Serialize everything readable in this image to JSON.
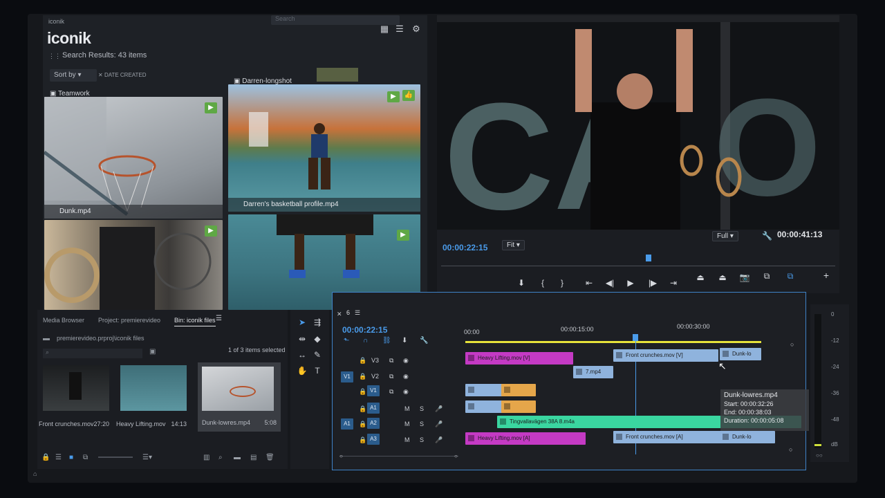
{
  "iconik": {
    "app_small": "iconik",
    "logo": "iconik",
    "search_placeholder": "Search",
    "results": "Search Results: 43 items",
    "sort_label": "Sort by",
    "date_filter": "DATE CREATED",
    "group_left": "Teamwork",
    "group_right": "Darren-longshot",
    "assets": [
      {
        "name": "Dunk.mp4"
      },
      {
        "name": "Darren's basketball profile.mp4"
      },
      {
        "name": ""
      },
      {
        "name": ""
      }
    ]
  },
  "monitor": {
    "timecode_current": "00:00:22:15",
    "fit": "Fit",
    "quality": "Full",
    "timecode_duration": "00:00:41:13"
  },
  "project": {
    "tabs": [
      "Media Browser",
      "Project: premierevideo",
      "Bin: iconik files"
    ],
    "path": "premierevideo.prproj\\iconik files",
    "selection": "1 of 3 items selected",
    "items": [
      {
        "name": "Front crunches.mov",
        "duration": "27:20"
      },
      {
        "name": "Heavy Lifting.mov",
        "duration": "14:13"
      },
      {
        "name": "Dunk-lowres.mp4",
        "duration": "5:08"
      }
    ]
  },
  "timeline": {
    "tab": "6",
    "timecode": "00:00:22:15",
    "ruler": [
      "00:00",
      "00:00:15:00",
      "00:00:30:00"
    ],
    "tracks": {
      "v3": "V3",
      "v2": "V2",
      "v1": "V1",
      "a1": "A1",
      "a2": "A2",
      "a3": "A3",
      "src_v": "V1",
      "src_a": "A1",
      "m": "M",
      "s": "S"
    },
    "clips": {
      "heavy_v": "Heavy Lifting.mov [V]",
      "front_v": "Front crunches.mov [V]",
      "dunk_v": "Dunk-lo",
      "seven": "7.mp4",
      "audio_green": "Tingvallavägen 38A 8.m4a",
      "heavy_a": "Heavy Lifting.mov [A]",
      "front_a": "Front crunches.mov [A]",
      "dunk_a": "Dunk-lo"
    },
    "tooltip": {
      "title": "Dunk-lowres.mp4",
      "start": "Start: 00:00:32:26",
      "end": "End: 00:00:38:03",
      "duration": "Duration: 00:00:05:08"
    }
  },
  "meter": {
    "labels": [
      "0",
      "-12",
      "-24",
      "-36",
      "-48",
      "dB"
    ]
  },
  "colors": {
    "accent": "#4a9bea",
    "badge": "#5fa845",
    "magenta": "#c43ac4",
    "clip_blue": "#8fb3dd",
    "audio_green": "#3ad6a0"
  }
}
